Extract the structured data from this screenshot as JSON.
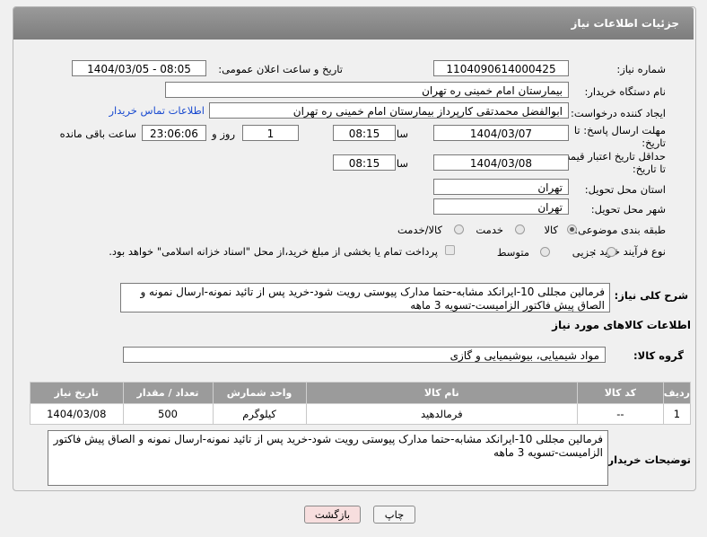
{
  "panel": {
    "title": "جزئیات اطلاعات نیاز"
  },
  "fields": {
    "need_number_label": "شماره نیاز:",
    "need_number": "1104090614000425",
    "announce_label": "تاریخ و ساعت اعلان عمومی:",
    "announce_value": "1404/03/05 - 08:05",
    "buyer_org_label": "نام دستگاه خریدار:",
    "buyer_org": "بیمارستان امام خمینی ره  تهران",
    "creator_label": "ایجاد کننده درخواست:",
    "creator": "ابوالفضل محمدتقی کارپرداز بیمارستان امام خمینی ره  تهران",
    "contact_link": "اطلاعات تماس خریدار",
    "deadline_label": "مهلت ارسال پاسخ: تا تاریخ:",
    "deadline_date": "1404/03/07",
    "time_label": "ساعت",
    "deadline_time": "08:15",
    "days_value": "1",
    "days_label": "روز و",
    "remaining_time": "23:06:06",
    "remaining_label": "ساعت باقی مانده",
    "validity_label": "حداقل تاریخ اعتبار قیمت: تا تاریخ:",
    "validity_date": "1404/03/08",
    "validity_time": "08:15",
    "province_label": "استان محل تحویل:",
    "province": "تهران",
    "city_label": "شهر محل تحویل:",
    "city": "تهران",
    "category_label": "طبقه بندی موضوعی:",
    "category_options": [
      "کالا",
      "خدمت",
      "کالا/خدمت"
    ],
    "process_label": "نوع فرآیند خرید :",
    "process_options": [
      "جزیی",
      "متوسط"
    ],
    "payment_note": "پرداخت تمام یا بخشی از مبلغ خرید،از محل \"اسناد خزانه اسلامی\" خواهد بود.",
    "summary_label": "شرح کلی نیاز:",
    "summary": "فرمالین مجللی 10-ایرانکد مشابه-حتما مدارک پیوستی رویت شود-خرید پس از تائید نمونه-ارسال نمونه و الصاق پیش فاکتور الزامیست-تسویه 3 ماهه"
  },
  "goods": {
    "section_title": "اطلاعات کالاهای مورد نیاز",
    "group_label": "گروه کالا:",
    "group_value": "مواد شیمیایی، بیوشیمیایی و  گازی",
    "columns": [
      "ردیف",
      "کد کالا",
      "نام کالا",
      "واحد شمارش",
      "تعداد / مقدار",
      "تاریخ نیاز"
    ],
    "rows": [
      {
        "row": "1",
        "code": "--",
        "name": "فرمالدهید",
        "unit": "کیلوگرم",
        "qty": "500",
        "date": "1404/03/08"
      }
    ]
  },
  "buyer_notes": {
    "label": "توضیحات خریدار:",
    "text": "فرمالین مجللی 10-ایرانکد مشابه-حتما مدارک پیوستی رویت شود-خرید پس از تائید نمونه-ارسال نمونه و الصاق پیش فاکتور الزامیست-تسویه 3 ماهه"
  },
  "buttons": {
    "print": "چاپ",
    "back": "بازگشت"
  },
  "colors": {
    "header": "#8c8c8c",
    "link": "#1a4bd0",
    "back_button": "#f7dede"
  }
}
